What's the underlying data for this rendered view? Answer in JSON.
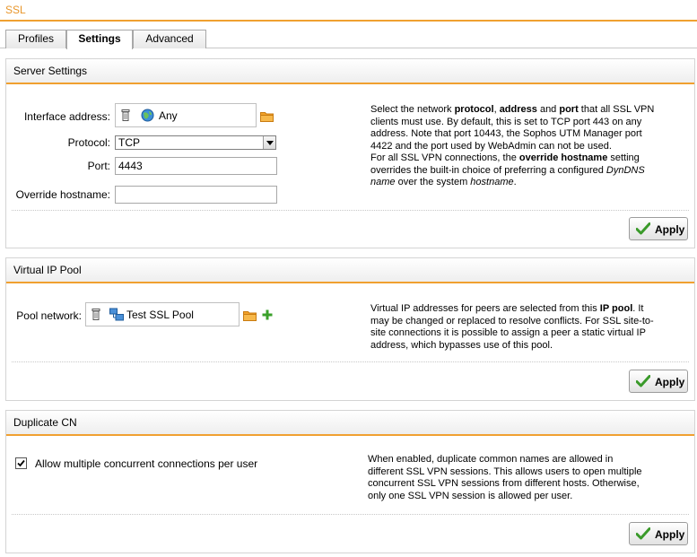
{
  "page_title": "SSL",
  "tabs": [
    {
      "label": "Profiles",
      "active": false
    },
    {
      "label": "Settings",
      "active": true
    },
    {
      "label": "Advanced",
      "active": false
    }
  ],
  "server_settings": {
    "title": "Server Settings",
    "interface_label": "Interface address:",
    "interface_value": "Any",
    "protocol_label": "Protocol:",
    "protocol_value": "TCP",
    "port_label": "Port:",
    "port_value": "4443",
    "override_label": "Override hostname:",
    "override_value": "",
    "help_lines": [
      "Select the network <b>protocol</b>, <b>address</b> and <b>port</b> that all SSL VPN",
      "clients must use. By default, this is set to TCP port 443 on any",
      "address. Note that port 10443, the Sophos UTM Manager port",
      "4422 and the port used by WebAdmin can not be used.",
      "For all SSL VPN connections, the <b>override hostname</b> setting",
      "overrides the built-in choice of preferring a configured <i>DynDNS</i>",
      "<i>name</i> over the system <i>hostname</i>."
    ],
    "apply_label": "Apply"
  },
  "virtual_ip_pool": {
    "title": "Virtual IP Pool",
    "pool_label": "Pool network:",
    "pool_value": "Test SSL Pool",
    "help_lines": [
      "Virtual IP addresses for peers are selected from this <b>IP pool</b>. It",
      "may be changed or replaced to resolve conflicts. For SSL site-to-",
      "site connections it is possible to assign a peer a static virtual IP",
      "address, which bypasses use of this pool."
    ],
    "apply_label": "Apply"
  },
  "duplicate_cn": {
    "title": "Duplicate CN",
    "checkbox_label": "Allow multiple concurrent connections per user",
    "checked": true,
    "help_lines": [
      "When enabled, duplicate common names are allowed in",
      "different SSL VPN sessions. This allows users to open multiple",
      "concurrent SSL VPN sessions from different hosts. Otherwise,",
      "only one SSL VPN session is allowed per user."
    ],
    "apply_label": "Apply"
  },
  "colors": {
    "accent": "#f0a030",
    "title_text": "#e8962a",
    "check_green": "#3a9a2a"
  },
  "icons": {
    "trash": "trash-icon",
    "globe": "globe-network-icon",
    "pool": "network-pool-icon",
    "folder": "folder-icon",
    "plus": "plus-icon",
    "check": "check-icon"
  }
}
